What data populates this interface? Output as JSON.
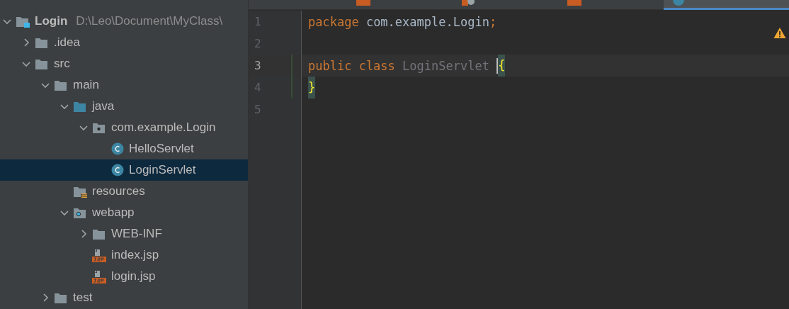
{
  "tabs": [
    {
      "kind": "jsp",
      "selected": false
    },
    {
      "kind": "web",
      "selected": false
    },
    {
      "kind": "jsp",
      "selected": false
    },
    {
      "kind": "class",
      "selected": true
    }
  ],
  "project_tree": [
    {
      "label": "Login",
      "path": "D:\\Leo\\Document\\MyClass\\",
      "kind": "module",
      "expanded": true,
      "selected": false,
      "children": [
        {
          "label": ".idea",
          "kind": "folder",
          "expanded": false,
          "selected": false
        },
        {
          "label": "src",
          "kind": "folder",
          "expanded": true,
          "selected": false,
          "children": [
            {
              "label": "main",
              "kind": "folder",
              "expanded": true,
              "selected": false,
              "children": [
                {
                  "label": "java",
                  "kind": "source",
                  "expanded": true,
                  "selected": false,
                  "children": [
                    {
                      "label": "com.example.Login",
                      "kind": "package",
                      "expanded": true,
                      "selected": false,
                      "children": [
                        {
                          "label": "HelloServlet",
                          "kind": "class",
                          "selected": false
                        },
                        {
                          "label": "LoginServlet",
                          "kind": "class",
                          "selected": true
                        }
                      ]
                    }
                  ]
                },
                {
                  "label": "resources",
                  "kind": "resources",
                  "selected": false
                },
                {
                  "label": "webapp",
                  "kind": "web",
                  "expanded": true,
                  "selected": false,
                  "children": [
                    {
                      "label": "WEB-INF",
                      "kind": "folder",
                      "expanded": false,
                      "selected": false
                    },
                    {
                      "label": "index.jsp",
                      "kind": "jsp",
                      "selected": false
                    },
                    {
                      "label": "login.jsp",
                      "kind": "jsp",
                      "selected": false
                    }
                  ]
                }
              ]
            },
            {
              "label": "test",
              "kind": "folder",
              "expanded": false,
              "selected": false
            }
          ]
        }
      ]
    }
  ],
  "editor": {
    "warning": true,
    "lines": [
      {
        "number": "1",
        "current": false,
        "changed": false,
        "tokens": [
          {
            "text": "package",
            "kind": "keyword"
          },
          {
            "text": " com.example.Login",
            "kind": "plain"
          },
          {
            "text": ";",
            "kind": "keyword"
          }
        ]
      },
      {
        "number": "2",
        "current": false,
        "changed": false
      },
      {
        "number": "3",
        "current": true,
        "changed": true,
        "tokens": [
          {
            "text": "public class",
            "kind": "keyword"
          },
          {
            "text": " LoginServlet ",
            "kind": "unused"
          },
          {
            "text": "{",
            "kind": "brace",
            "caret": true
          }
        ]
      },
      {
        "number": "4",
        "current": false,
        "changed": true,
        "tokens": [
          {
            "text": "}",
            "kind": "brace"
          }
        ]
      },
      {
        "number": "5",
        "current": false,
        "changed": false
      }
    ]
  }
}
